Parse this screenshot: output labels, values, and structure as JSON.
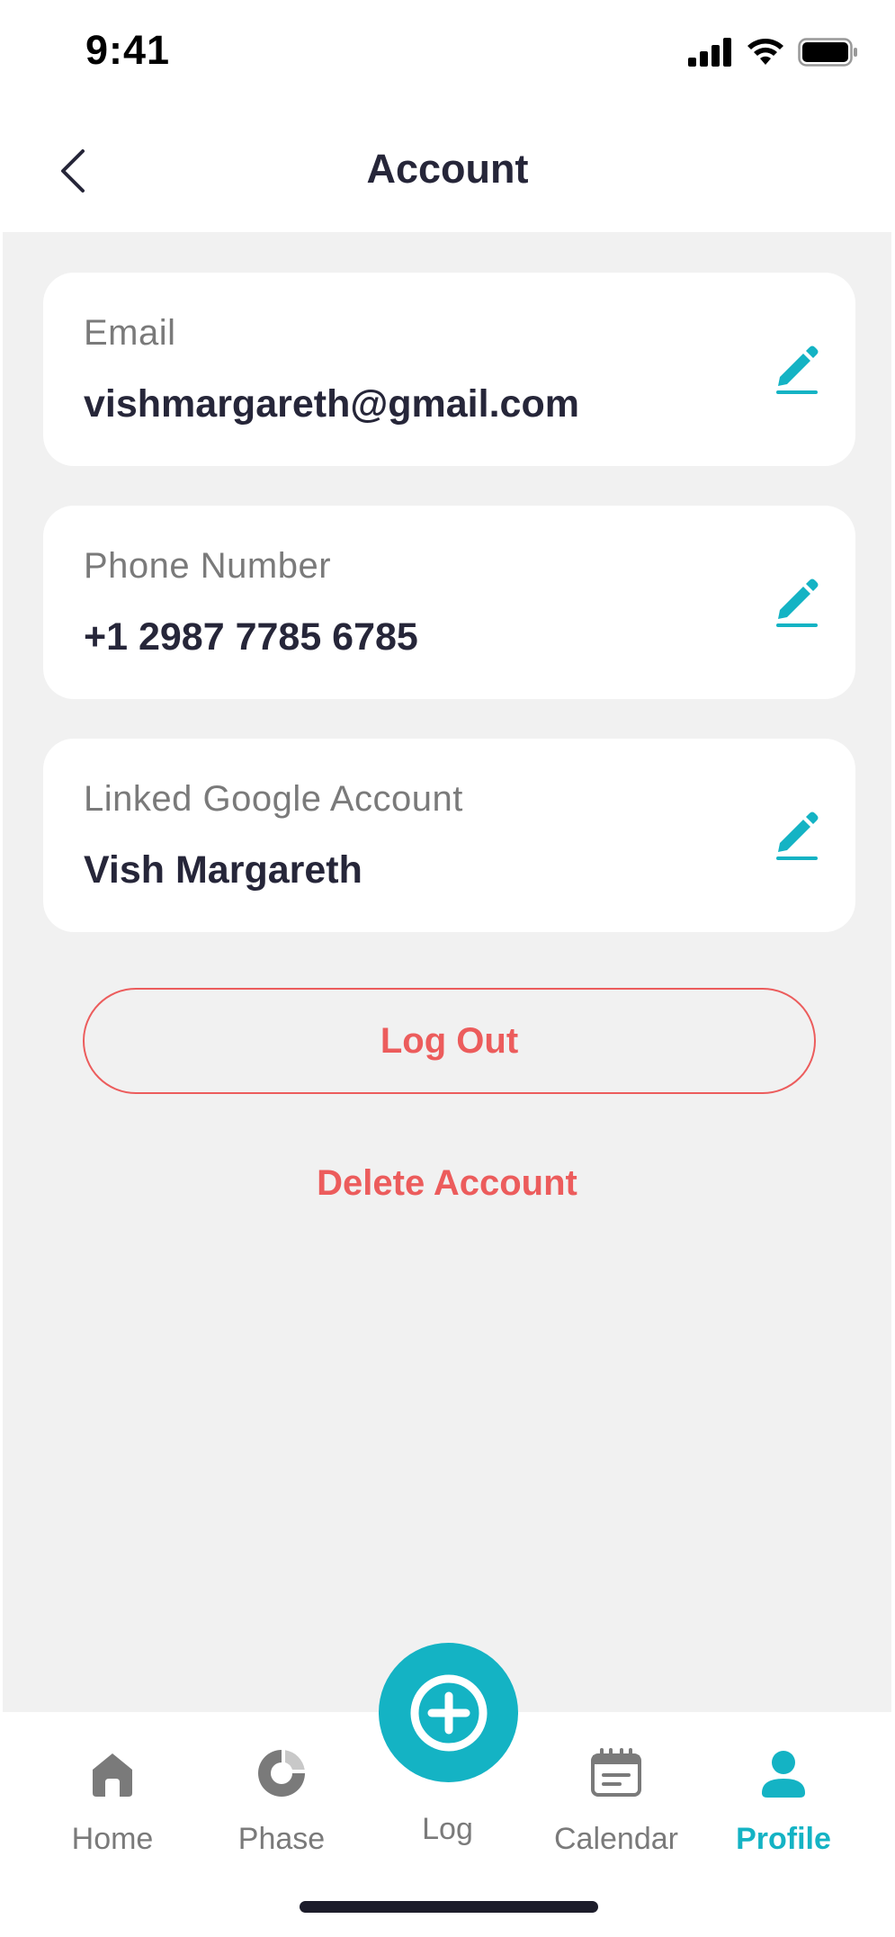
{
  "status_bar": {
    "time": "9:41"
  },
  "header": {
    "title": "Account"
  },
  "fields": [
    {
      "label": "Email",
      "value": "vishmargareth@gmail.com"
    },
    {
      "label": "Phone Number",
      "value": "+1 2987 7785 6785"
    },
    {
      "label": "Linked Google Account",
      "value": "Vish Margareth"
    }
  ],
  "actions": {
    "logout_label": "Log Out",
    "delete_label": "Delete Account"
  },
  "tabbar": {
    "items": [
      {
        "label": "Home",
        "icon": "home-icon"
      },
      {
        "label": "Phase",
        "icon": "phase-icon"
      },
      {
        "label": "Log",
        "icon": "plus-circle-icon"
      },
      {
        "label": "Calendar",
        "icon": "calendar-icon"
      },
      {
        "label": "Profile",
        "icon": "user-icon",
        "active": true
      }
    ]
  },
  "colors": {
    "accent": "#14b3c4",
    "danger": "#ec5c5c",
    "text_dark": "#262639",
    "text_muted": "#7a7a7a",
    "background": "#f1f1f1"
  }
}
